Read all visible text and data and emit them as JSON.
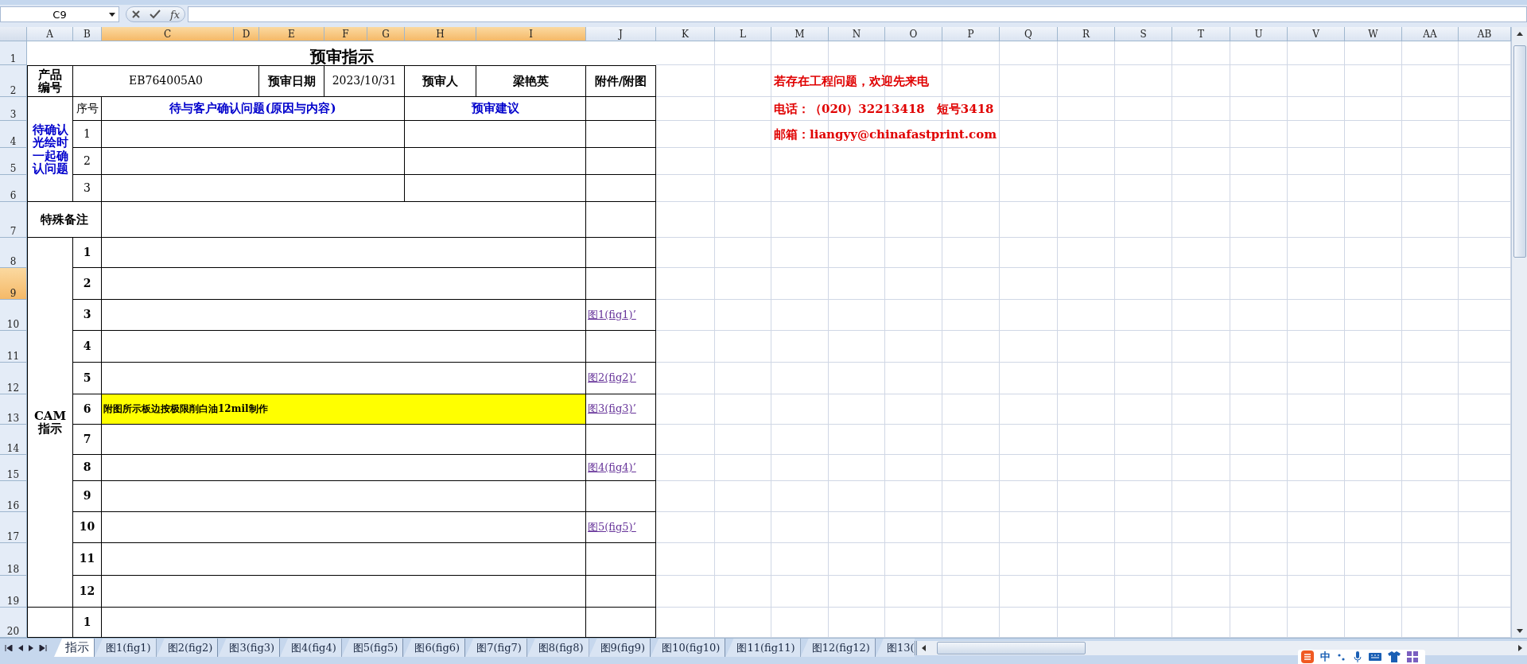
{
  "formula_bar": {
    "name_box": "C9",
    "function_label": "fx"
  },
  "column_headers": [
    {
      "label": "A",
      "selected": false
    },
    {
      "label": "B",
      "selected": false
    },
    {
      "label": "C",
      "selected": true
    },
    {
      "label": "D",
      "selected": true
    },
    {
      "label": "E",
      "selected": true
    },
    {
      "label": "F",
      "selected": true
    },
    {
      "label": "G",
      "selected": true
    },
    {
      "label": "H",
      "selected": true
    },
    {
      "label": "I",
      "selected": true
    },
    {
      "label": "J",
      "selected": false
    },
    {
      "label": "K",
      "selected": false
    },
    {
      "label": "L",
      "selected": false
    },
    {
      "label": "M",
      "selected": false
    },
    {
      "label": "N",
      "selected": false
    },
    {
      "label": "O",
      "selected": false
    },
    {
      "label": "P",
      "selected": false
    },
    {
      "label": "Q",
      "selected": false
    },
    {
      "label": "R",
      "selected": false
    },
    {
      "label": "S",
      "selected": false
    },
    {
      "label": "T",
      "selected": false
    },
    {
      "label": "U",
      "selected": false
    },
    {
      "label": "V",
      "selected": false
    },
    {
      "label": "W",
      "selected": false
    },
    {
      "label": "AA",
      "selected": false
    },
    {
      "label": "AB",
      "selected": false
    }
  ],
  "row_headers": [
    {
      "label": "1",
      "selected": false
    },
    {
      "label": "2",
      "selected": false
    },
    {
      "label": "3",
      "selected": false
    },
    {
      "label": "4",
      "selected": false
    },
    {
      "label": "5",
      "selected": false
    },
    {
      "label": "6",
      "selected": false
    },
    {
      "label": "7",
      "selected": false
    },
    {
      "label": "8",
      "selected": false
    },
    {
      "label": "9",
      "selected": true
    },
    {
      "label": "10",
      "selected": false
    },
    {
      "label": "11",
      "selected": false
    },
    {
      "label": "12",
      "selected": false
    },
    {
      "label": "13",
      "selected": false
    },
    {
      "label": "14",
      "selected": false
    },
    {
      "label": "15",
      "selected": false
    },
    {
      "label": "16",
      "selected": false
    },
    {
      "label": "17",
      "selected": false
    },
    {
      "label": "18",
      "selected": false
    },
    {
      "label": "19",
      "selected": false
    },
    {
      "label": "20",
      "selected": false
    }
  ],
  "sheet": {
    "title": "预审指示",
    "product_label": "产品编号",
    "product_no": "EB764005A0",
    "date_label": "预审日期",
    "date": "2023/10/31",
    "reviewer_label": "预审人",
    "reviewer": "梁艳英",
    "attachment_header": "附件/附图",
    "pending": {
      "label": "待确认光绘时一起确认问题",
      "seq_header": "序号",
      "question_header": "待与客户确认问题(原因与内容)",
      "advice_header": "预审建议",
      "rows": [
        "1",
        "2",
        "3"
      ]
    },
    "special_note_label": "特殊备注",
    "cam": {
      "label": "CAM指示",
      "rows": [
        {
          "no": "1",
          "highlighted": false
        },
        {
          "no": "2",
          "highlighted": false
        },
        {
          "no": "3",
          "highlighted": false,
          "attachment": "图1(fig1)’"
        },
        {
          "no": "4",
          "highlighted": false
        },
        {
          "no": "5",
          "highlighted": false,
          "attachment": "图2(fig2)’"
        },
        {
          "no": "6",
          "highlighted": true,
          "text": "附图所示板边按极限削白油12mil制作",
          "attachment": "图3(fig3)’"
        },
        {
          "no": "7",
          "highlighted": false
        },
        {
          "no": "8",
          "highlighted": false,
          "attachment": "图4(fig4)’"
        },
        {
          "no": "9",
          "highlighted": false
        },
        {
          "no": "10",
          "highlighted": false,
          "attachment": "图5(fig5)’"
        },
        {
          "no": "11",
          "highlighted": false
        },
        {
          "no": "12",
          "highlighted": false
        }
      ]
    },
    "next_rows": [
      "1"
    ],
    "contact": [
      "若存在工程问题，欢迎先来电",
      "电话：（020）32213418　短号3418",
      "邮箱：liangyy@chinafastprint.com"
    ]
  },
  "sheet_tabs": [
    {
      "label": "指示",
      "selected": true
    },
    {
      "label": "图1(fig1)",
      "selected": false
    },
    {
      "label": "图2(fig2)",
      "selected": false
    },
    {
      "label": "图3(fig3)",
      "selected": false
    },
    {
      "label": "图4(fig4)",
      "selected": false
    },
    {
      "label": "图5(fig5)",
      "selected": false
    },
    {
      "label": "图6(fig6)",
      "selected": false
    },
    {
      "label": "图7(fig7)",
      "selected": false
    },
    {
      "label": "图8(fig8)",
      "selected": false
    },
    {
      "label": "图9(fig9)",
      "selected": false
    },
    {
      "label": "图10(fig10)",
      "selected": false
    },
    {
      "label": "图11(fig11)",
      "selected": false
    },
    {
      "label": "图12(fig12)",
      "selected": false
    },
    {
      "label": "图13(",
      "selected": false
    }
  ],
  "ime": {
    "mode": "中"
  }
}
